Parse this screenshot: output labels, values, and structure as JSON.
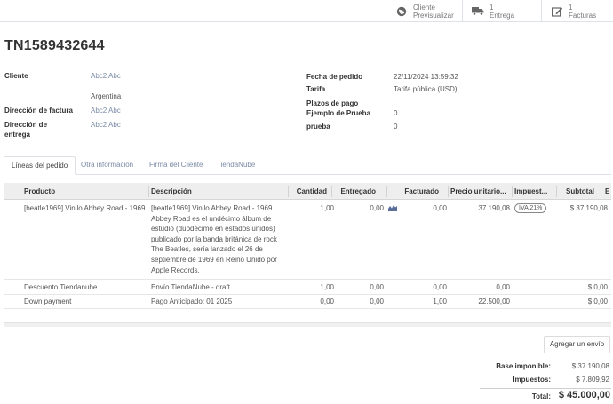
{
  "smart_buttons": [
    {
      "icon": "globe-icon",
      "line1": "Cliente",
      "line2": "Previsualizar"
    },
    {
      "icon": "truck-icon",
      "line1": "1",
      "line2": "Entrega"
    },
    {
      "icon": "edit-icon",
      "line1": "1",
      "line2": "Facturas"
    }
  ],
  "order": {
    "title": "TN1589432644",
    "left": {
      "cliente_label": "Cliente",
      "cliente_value": "Abc2 Abc",
      "cliente_country": "Argentina",
      "factura_label": "Dirección de factura",
      "factura_value": "Abc2 Abc",
      "entrega_label_1": "Dirección de",
      "entrega_label_2": "entrega",
      "entrega_value": "Abc2 Abc"
    },
    "right": {
      "fecha_label": "Fecha de pedido",
      "fecha_value": "22/11/2024 13:59:32",
      "tarifa_label": "Tarifa",
      "tarifa_value": "Tarifa pública (USD)",
      "plazos_label": "Plazos de pago",
      "ejemplo_label": "Ejemplo de Prueba",
      "ejemplo_value": "0",
      "prueba_label": "prueba",
      "prueba_value": "0"
    }
  },
  "tabs": [
    "Líneas del pedido",
    "Otra información",
    "Firma del Cliente",
    "TiendaNube"
  ],
  "table": {
    "headers": {
      "producto": "Producto",
      "descripcion": "Descripción",
      "cantidad": "Cantidad",
      "entregado": "Entregado",
      "facturado": "Facturado",
      "precio": "Precio unitario...",
      "impuestos": "Impuest...",
      "subtotal": "Subtotal"
    },
    "rows": [
      {
        "producto": "[beatle1969] Vinilo Abbey Road - 1969",
        "descripcion": [
          "[beatle1969] Vinilo Abbey Road - 1969",
          "Abbey Road es el undécimo álbum de",
          "estudio (duodécimo en estados unidos)",
          "publicado por la banda británica de rock",
          "The Beatles, sería lanzado el 26 de",
          "septiembre de 1969 en Reino Unido por",
          "Apple Records."
        ],
        "cantidad": "1,00",
        "entregado": "0,00",
        "facturado": "0,00",
        "precio": "37.190,08",
        "impuesto": "IVA 21%",
        "subtotal": "$ 37.190,08"
      },
      {
        "producto": "Descuento Tiendanube",
        "descripcion": [
          "Envío TiendaNube - draft"
        ],
        "cantidad": "1,00",
        "entregado": "0,00",
        "facturado": "0,00",
        "precio": "0,00",
        "impuesto": "",
        "subtotal": "$ 0,00"
      },
      {
        "producto": "Down payment",
        "descripcion": [
          "Pago Anticipado: 01 2025"
        ],
        "cantidad": "0,00",
        "entregado": "0,00",
        "facturado": "1,00",
        "precio": "22.500,00",
        "impuesto": "",
        "subtotal": "$ 0,00"
      }
    ]
  },
  "add_button": "Agregar un envío",
  "totals": {
    "base_label": "Base imponible:",
    "base_value": "$ 37.190,08",
    "imp_label": "Impuestos:",
    "imp_value": "$ 7.809,92",
    "total_label": "Total:",
    "total_value": "$ 45.000,00"
  }
}
